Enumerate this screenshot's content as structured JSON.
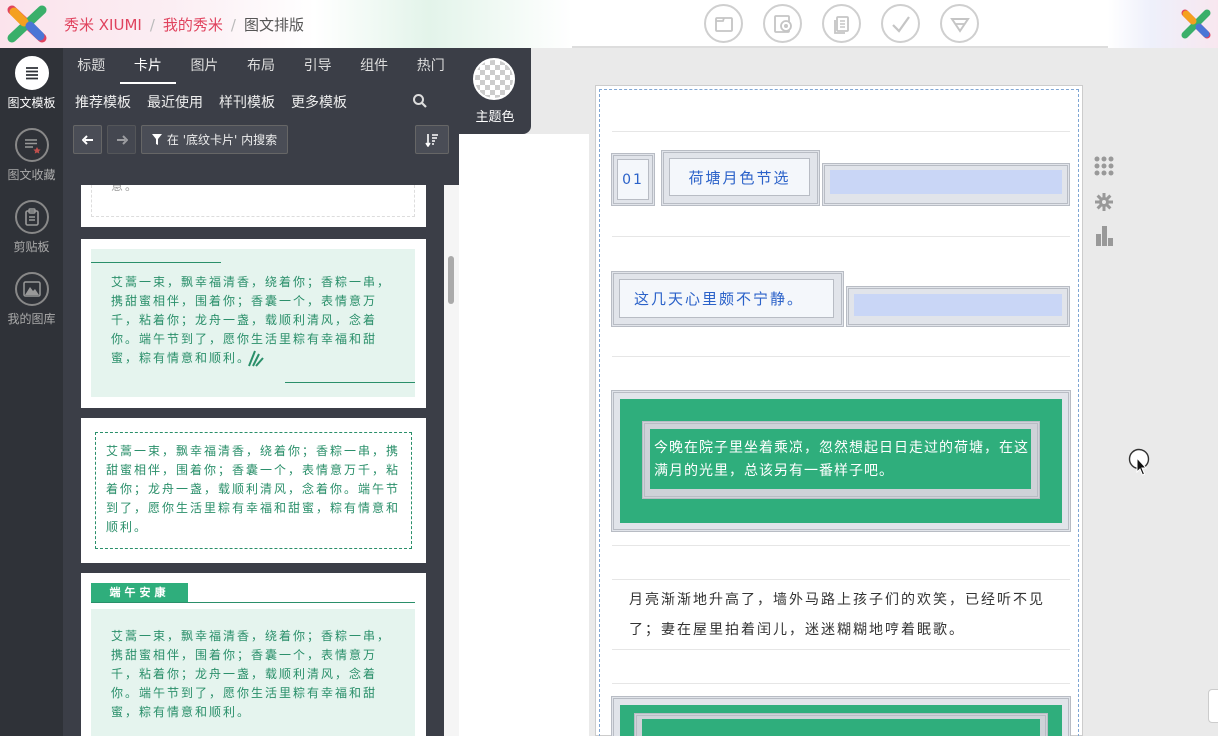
{
  "header": {
    "brand": "秀米 XIUMI",
    "breadcrumb_my": "我的秀米",
    "breadcrumb_current": "图文排版",
    "brand_color": "#e0435e"
  },
  "toolbar_icons": [
    "folder-icon",
    "preview-icon",
    "copy-icon",
    "check-icon",
    "download-icon"
  ],
  "leftnav": [
    {
      "label": "图文模板",
      "icon": "list-icon",
      "active": true
    },
    {
      "label": "图文收藏",
      "icon": "favorite-list-icon",
      "active": false
    },
    {
      "label": "剪贴板",
      "icon": "clipboard-icon",
      "active": false
    },
    {
      "label": "我的图库",
      "icon": "image-icon",
      "active": false
    }
  ],
  "tabs": [
    "标题",
    "卡片",
    "图片",
    "布局",
    "引导",
    "组件",
    "热门"
  ],
  "active_tab": "卡片",
  "subtabs": [
    "推荐模板",
    "最近使用",
    "样刊模板",
    "更多模板"
  ],
  "filter_label": "在 '底纹卡片' 内搜索",
  "theme_label": "主题色",
  "cards": {
    "partial_text": "意。",
    "poem": "艾蒿一束，飘幸福清香，绕着你；香粽一串，携甜蜜相伴，围着你；香囊一个，表情意万千，粘着你；龙舟一盏，载顺利清风，念着你。端午节到了，愿你生活里粽有幸福和甜蜜，粽有情意和顺利。",
    "title_tag": "端午安康"
  },
  "editor": {
    "num": "01",
    "title1": "荷塘月色节选",
    "title2": "这几天心里颇不宁静。",
    "green_text": "今晚在院子里坐着乘凉，忽然想起日日走过的荷塘，在这满月的光里，总该另有一番样子吧。",
    "para": "月亮渐渐地升高了，墙外马路上孩子们的欢笑，已经听不见了；妻在屋里拍着闰儿，迷迷糊糊地哼着眠歌。",
    "green_color": "#2fae7c"
  },
  "sidetools": [
    "grid-icon",
    "gear-icon",
    "bar-chart-icon"
  ]
}
